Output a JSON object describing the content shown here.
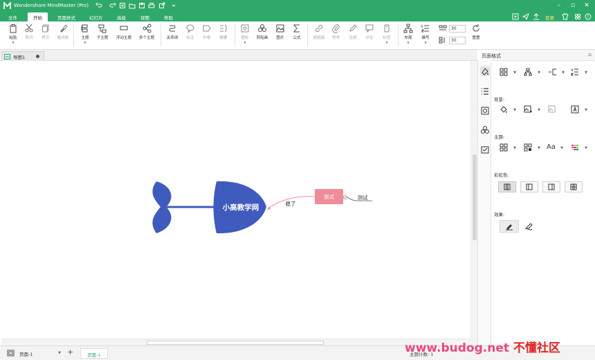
{
  "app": {
    "title": "Wondershare MindMaster (Pro)",
    "login": "登录"
  },
  "menu": {
    "tabs": [
      {
        "label": "文件"
      },
      {
        "label": "开始"
      },
      {
        "label": "页面样式"
      },
      {
        "label": "幻灯片"
      },
      {
        "label": "高级"
      },
      {
        "label": "视图"
      },
      {
        "label": "帮助"
      }
    ],
    "active": "开始"
  },
  "toolbar": {
    "paste": "粘贴",
    "cut": "剪切",
    "copy": "拷贝",
    "format_painter": "格式刷",
    "topic": "主题",
    "subtopic": "子主题",
    "floating_topic": "浮动主题",
    "multi_topic": "多个主题",
    "relationship": "关系线",
    "callout": "标注",
    "boundary": "外框",
    "summary": "概要",
    "icon": "图标",
    "clipart": "剪贴画",
    "image": "图片",
    "formula": "公式",
    "hyperlink": "超链接",
    "attachment": "附件",
    "note": "注释",
    "comment": "评论",
    "tag": "标签",
    "layout": "布局",
    "numbering": "编号",
    "spacing_h": "30",
    "spacing_v": "30",
    "reset": "重置"
  },
  "document": {
    "tab_label": "导图1"
  },
  "mindmap": {
    "central_topic": "小高教学网",
    "relation_label": "稳了",
    "floating_topic": "测试",
    "subtopic": "测试",
    "colors": {
      "central": "#3f5bbd",
      "floating": "#f08c9a",
      "relation": "#f08c9a"
    }
  },
  "panel": {
    "title": "页面格式",
    "background_label": "背景:",
    "theme_label": "主题:",
    "rainbow_label": "彩虹色:",
    "effect_label": "效果:",
    "theme_font": "Aa"
  },
  "status": {
    "page_select": "页面-1",
    "page_tab": "页面-1",
    "count_label": "主题计数: 1"
  },
  "watermark": {
    "url": "www.budog.net",
    "cn": "不懂社区"
  },
  "accent": "#2fa96a"
}
